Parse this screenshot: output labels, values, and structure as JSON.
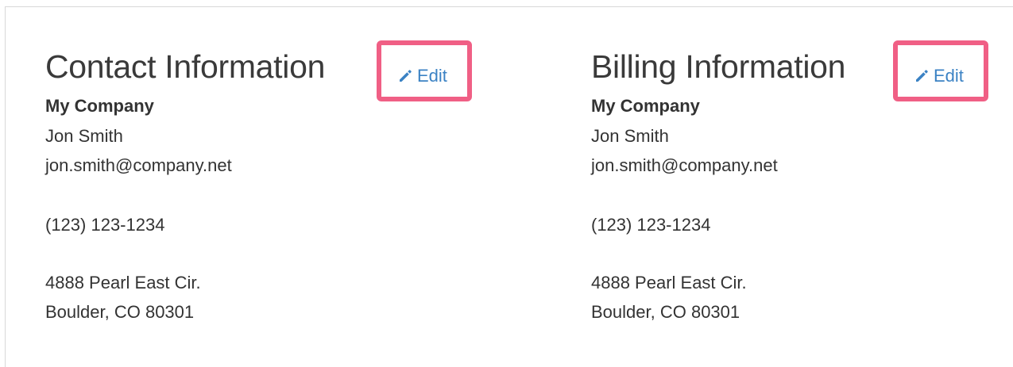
{
  "sections": [
    {
      "title": "Contact Information",
      "edit_label": "Edit",
      "company": "My Company",
      "name": "Jon Smith",
      "email": "jon.smith@company.net",
      "phone": "(123) 123-1234",
      "street": "4888 Pearl East Cir.",
      "city": "Boulder, CO 80301"
    },
    {
      "title": "Billing Information",
      "edit_label": "Edit",
      "company": "My Company",
      "name": "Jon Smith",
      "email": "jon.smith@company.net",
      "phone": "(123) 123-1234",
      "street": "4888 Pearl East Cir.",
      "city": "Boulder, CO 80301"
    }
  ],
  "colors": {
    "link": "#3b82c4",
    "highlight": "#f05f85",
    "text": "#333333"
  },
  "icons": {
    "edit": "pencil-icon"
  }
}
